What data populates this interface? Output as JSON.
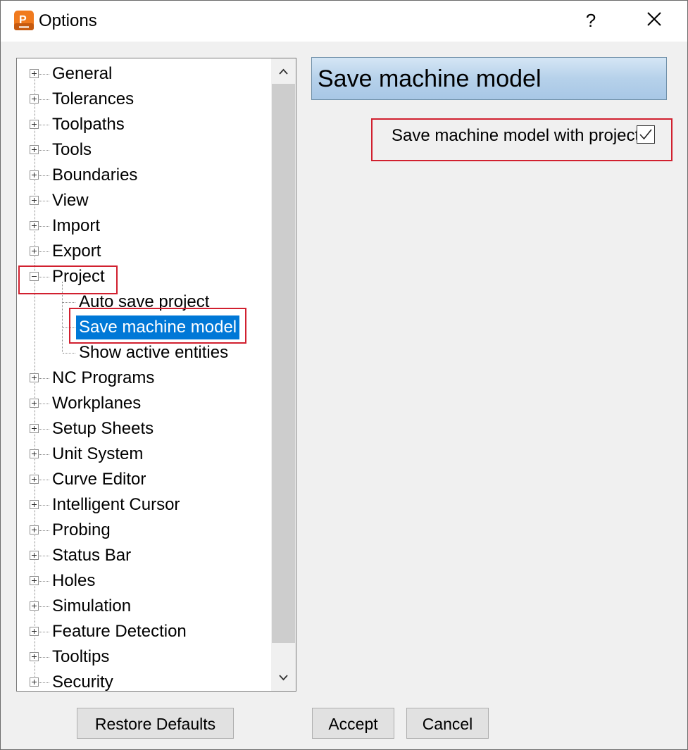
{
  "window": {
    "title": "Options",
    "help_label": "?"
  },
  "tree": {
    "items": [
      {
        "label": "General",
        "expander": "plus"
      },
      {
        "label": "Tolerances",
        "expander": "plus"
      },
      {
        "label": "Toolpaths",
        "expander": "plus"
      },
      {
        "label": "Tools",
        "expander": "plus"
      },
      {
        "label": "Boundaries",
        "expander": "plus"
      },
      {
        "label": "View",
        "expander": "plus"
      },
      {
        "label": "Import",
        "expander": "plus"
      },
      {
        "label": "Export",
        "expander": "plus"
      },
      {
        "label": "Project",
        "expander": "minus"
      },
      {
        "label": "Auto save project",
        "child": true
      },
      {
        "label": "Save machine model",
        "child": true,
        "selected": true
      },
      {
        "label": "Show active entities",
        "child": true
      },
      {
        "label": "NC Programs",
        "expander": "plus"
      },
      {
        "label": "Workplanes",
        "expander": "plus"
      },
      {
        "label": "Setup Sheets",
        "expander": "plus"
      },
      {
        "label": "Unit System",
        "expander": "plus"
      },
      {
        "label": "Curve Editor",
        "expander": "plus"
      },
      {
        "label": "Intelligent Cursor",
        "expander": "plus"
      },
      {
        "label": "Probing",
        "expander": "plus"
      },
      {
        "label": "Status Bar",
        "expander": "plus"
      },
      {
        "label": "Holes",
        "expander": "plus"
      },
      {
        "label": "Simulation",
        "expander": "plus"
      },
      {
        "label": "Feature Detection",
        "expander": "plus"
      },
      {
        "label": "Tooltips",
        "expander": "plus"
      },
      {
        "label": "Security",
        "expander": "plus"
      }
    ]
  },
  "panel": {
    "heading": "Save machine model",
    "option_label": "Save machine model with project",
    "option_checked": true
  },
  "buttons": {
    "restore_defaults": "Restore Defaults",
    "accept": "Accept",
    "cancel": "Cancel"
  },
  "colors": {
    "selection": "#0078d7",
    "highlight_box": "#d1202f",
    "app_icon": "#f07a1e"
  },
  "icons": [
    "app-icon",
    "help-icon",
    "close-icon",
    "expand-plus-icon",
    "collapse-minus-icon",
    "scroll-up-arrow-icon",
    "scroll-down-arrow-icon",
    "checkbox-checked-icon"
  ]
}
